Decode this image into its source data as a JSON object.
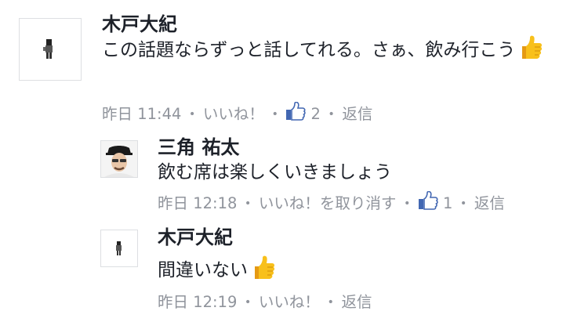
{
  "comments": [
    {
      "author": "木戸大紀",
      "text": "この話題ならずっと話してれる。さぁ、飲み行こう",
      "time": "昨日 11:44",
      "like_label": "いいね！",
      "like_count": "2",
      "reply_label": "返信",
      "emoji": "thumbs-up"
    },
    {
      "author": "三角 祐太",
      "text": "飲む席は楽しくいきましょう",
      "time": "昨日 12:18",
      "like_label": "いいね！を取り消す",
      "like_count": "1",
      "reply_label": "返信"
    },
    {
      "author": "木戸大紀",
      "text": "間違いない",
      "time": "昨日 12:19",
      "like_label": "いいね！",
      "reply_label": "返信",
      "emoji": "thumbs-up"
    }
  ],
  "meta_separator": "・",
  "colors": {
    "meta_text": "#90949c",
    "like_icon_blue": "#4267b2",
    "avatar_border": "#dddfe2",
    "emoji_yellow": "#f8c01b"
  }
}
